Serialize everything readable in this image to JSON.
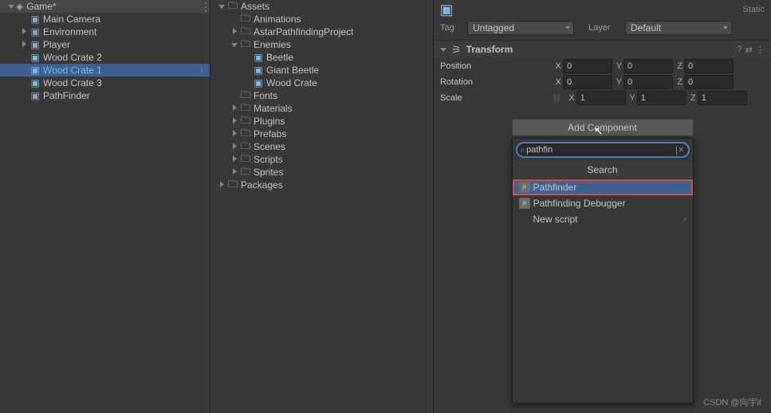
{
  "hierarchy": {
    "scene": "Game*",
    "items": [
      {
        "label": "Main Camera",
        "selected": false
      },
      {
        "label": "Environment",
        "selected": false,
        "expandable": true
      },
      {
        "label": "Player",
        "selected": false,
        "expandable": true
      },
      {
        "label": "Wood Crate 2",
        "selected": false
      },
      {
        "label": "Wood Crate 1",
        "selected": true
      },
      {
        "label": "Wood Crate 3",
        "selected": false
      },
      {
        "label": "PathFinder",
        "selected": false
      }
    ]
  },
  "project": {
    "root": "Assets",
    "folders": [
      {
        "label": "Animations",
        "indent": 1
      },
      {
        "label": "AstarPathfindingProject",
        "indent": 1,
        "expandable": true
      },
      {
        "label": "Enemies",
        "indent": 1,
        "expanded": true
      },
      {
        "label": "Beetle",
        "indent": 2,
        "prefab": true
      },
      {
        "label": "Giant Beetle",
        "indent": 2,
        "prefab": true
      },
      {
        "label": "Wood Crate",
        "indent": 2,
        "prefab": true
      },
      {
        "label": "Fonts",
        "indent": 1
      },
      {
        "label": "Materials",
        "indent": 1,
        "expandable": true
      },
      {
        "label": "Plugins",
        "indent": 1,
        "expandable": true
      },
      {
        "label": "Prefabs",
        "indent": 1,
        "expandable": true
      },
      {
        "label": "Scenes",
        "indent": 1,
        "expandable": true
      },
      {
        "label": "Scripts",
        "indent": 1,
        "expandable": true
      },
      {
        "label": "Sprites",
        "indent": 1,
        "expandable": true
      }
    ],
    "packages": "Packages"
  },
  "inspector": {
    "tag_label": "Tag",
    "tag_value": "Untagged",
    "layer_label": "Layer",
    "layer_value": "Default",
    "static_label": "Static",
    "transform": {
      "title": "Transform",
      "position_label": "Position",
      "rotation_label": "Rotation",
      "scale_label": "Scale",
      "position": {
        "x": "0",
        "y": "0",
        "z": "0"
      },
      "rotation": {
        "x": "0",
        "y": "0",
        "z": "0"
      },
      "scale": {
        "x": "1",
        "y": "1",
        "z": "1"
      }
    },
    "add_component_label": "Add Component",
    "search": {
      "query": "pathfin",
      "header": "Search",
      "results": [
        {
          "label": "Pathfinder"
        },
        {
          "label": "Pathfinding Debugger"
        },
        {
          "label": "New script",
          "arrow": true
        }
      ]
    }
  },
  "watermark": "CSDN @向宇it"
}
